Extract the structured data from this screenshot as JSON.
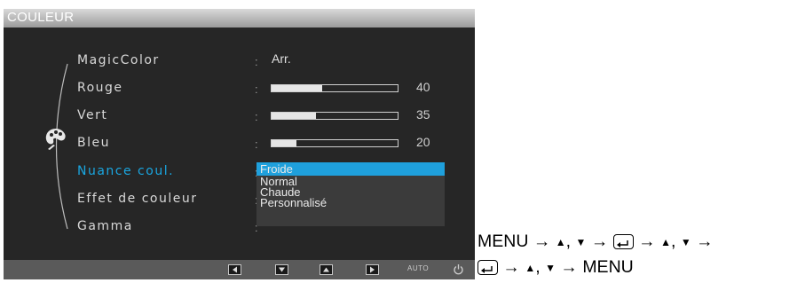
{
  "osd": {
    "title": "COULEUR",
    "menu_items": [
      {
        "label": "MagicColor"
      },
      {
        "label": "Rouge"
      },
      {
        "label": "Vert"
      },
      {
        "label": "Bleu"
      },
      {
        "label": "Nuance coul."
      },
      {
        "label": "Effet de couleur"
      },
      {
        "label": "Gamma"
      }
    ],
    "active_item": "Nuance coul.",
    "colon": ":",
    "magiccolor_value": "Arr.",
    "sliders": [
      {
        "name": "Rouge",
        "value": "40",
        "level": 0.4
      },
      {
        "name": "Vert",
        "value": "35",
        "level": 0.35
      },
      {
        "name": "Bleu",
        "value": "20",
        "level": 0.2
      }
    ],
    "dropdown": {
      "options": [
        "Froide",
        "Normal",
        "Chaude",
        "Personnalisé"
      ],
      "selected": "Froide"
    },
    "bottom_bar": {
      "buttons": [
        "left-arrow",
        "down-arrow",
        "up-arrow",
        "right-arrow"
      ],
      "auto_label": "AUTO",
      "power": "power-icon"
    },
    "colors": {
      "accent": "#1fa0dc",
      "background": "#262626",
      "highlight_text": "#1aa6e0"
    }
  },
  "instructions": {
    "line1": {
      "menu": "MENU",
      "arrow": "→",
      "up": "▲",
      "sep": ",",
      "down": "▼"
    },
    "line2": {
      "menu": "MENU",
      "arrow": "→",
      "up": "▲",
      "sep": ",",
      "down": "▼"
    }
  }
}
